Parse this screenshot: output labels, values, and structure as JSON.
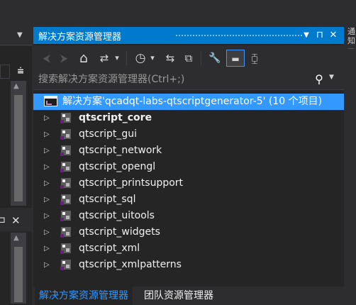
{
  "left_panel": {
    "dropdown_glyph": "▼",
    "filter_glyph": "⩧",
    "scroll_up_glyph": "▲",
    "pin_glyph": "⊐",
    "close_glyph": "✕"
  },
  "solution_explorer": {
    "title": "解决方案资源管理器",
    "title_buttons": [
      "▼",
      "⊓",
      "✕"
    ],
    "toolbar": [
      {
        "name": "back-button",
        "glyph": "⮜",
        "dim": true
      },
      {
        "name": "forward-button",
        "glyph": "⮞",
        "dim": true
      },
      {
        "name": "home-button",
        "glyph": "⌂"
      },
      {
        "name": "switch-views-button",
        "glyph": "⇄"
      },
      {
        "name": "switch-views-dropdown",
        "glyph": "▾"
      },
      {
        "name": "pending-changes-filter-button",
        "glyph": "◷"
      },
      {
        "name": "pending-changes-dropdown",
        "glyph": "▾"
      },
      {
        "name": "sync-button",
        "glyph": "⇆"
      },
      {
        "name": "collapse-all-button",
        "glyph": "⧉"
      },
      {
        "name": "properties-button",
        "glyph": "🔧"
      },
      {
        "name": "preview-button",
        "glyph": "▬"
      },
      {
        "name": "class-diagram-button",
        "glyph": "⧮"
      }
    ],
    "search": {
      "placeholder": "搜索解决方案资源管理器(Ctrl+;)",
      "search_glyph": "⚲",
      "dropdown_glyph": "▼"
    },
    "tree": {
      "solution": "解决方案'qcadqt-labs-qtscriptgenerator-5' (10 个项目)",
      "expand_glyph": "▷",
      "projects": [
        {
          "label": "qtscript_core",
          "bold": true
        },
        {
          "label": "qtscript_gui",
          "bold": false
        },
        {
          "label": "qtscript_network",
          "bold": false
        },
        {
          "label": "qtscript_opengl",
          "bold": false
        },
        {
          "label": "qtscript_printsupport",
          "bold": false
        },
        {
          "label": "qtscript_sql",
          "bold": false
        },
        {
          "label": "qtscript_uitools",
          "bold": false
        },
        {
          "label": "qtscript_widgets",
          "bold": false
        },
        {
          "label": "qtscript_xml",
          "bold": false
        },
        {
          "label": "qtscript_xmlpatterns",
          "bold": false
        }
      ]
    },
    "bottom_tabs": [
      "解决方案资源管理器",
      "团队资源管理器"
    ],
    "active_tab": 0
  },
  "right_strip": {
    "text": "通知"
  },
  "colors": {
    "accent": "#007acc",
    "selection": "#3399ff",
    "background": "#252526",
    "chrome": "#2d2d30"
  }
}
